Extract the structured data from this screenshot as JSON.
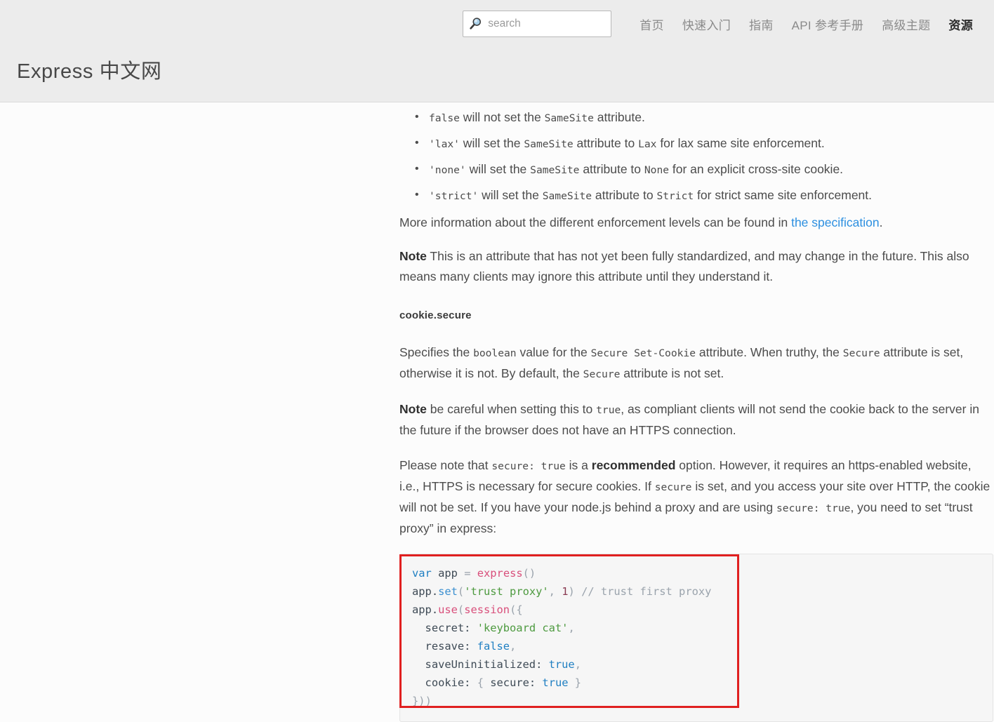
{
  "header": {
    "brand": "Express 中文网",
    "search": {
      "placeholder": "search",
      "value": "",
      "icon": "search-icon"
    },
    "nav": [
      {
        "label": "首页",
        "active": false
      },
      {
        "label": "快速入门",
        "active": false
      },
      {
        "label": "指南",
        "active": false
      },
      {
        "label": "API 参考手册",
        "active": false
      },
      {
        "label": "高级主题",
        "active": false
      },
      {
        "label": "资源",
        "active": true
      }
    ]
  },
  "content": {
    "samesite_bullets": [
      {
        "code": "false",
        "rest": " will not set the ",
        "code2": "SameSite",
        "rest2": " attribute.",
        "code3": "",
        "rest3": ""
      },
      {
        "code": "'lax'",
        "rest": " will set the ",
        "code2": "SameSite",
        "rest2": " attribute to ",
        "code3": "Lax",
        "rest3": " for lax same site enforcement."
      },
      {
        "code": "'none'",
        "rest": " will set the ",
        "code2": "SameSite",
        "rest2": " attribute to ",
        "code3": "None",
        "rest3": " for an explicit cross-site cookie."
      },
      {
        "code": "'strict'",
        "rest": " will set the ",
        "code2": "SameSite",
        "rest2": " attribute to ",
        "code3": "Strict",
        "rest3": " for strict same site enforcement."
      }
    ],
    "spec_paragraph": {
      "before": "More information about the different enforcement levels can be found in ",
      "link": "the specification",
      "after": "."
    },
    "note_1": {
      "label": "Note",
      "text": " This is an attribute that has not yet been fully standardized, and may change in the future. This also means many clients may ignore this attribute until they understand it."
    },
    "heading": "cookie.secure",
    "specifies_paragraph": {
      "p1": "Specifies the ",
      "c1": "boolean",
      "p2": " value for the ",
      "c2": "Secure Set-Cookie",
      "p3": " attribute. When truthy, the ",
      "c3": "Secure",
      "p4": " attribute is set, otherwise it is not. By default, the ",
      "c4": "Secure",
      "p5": " attribute is not set."
    },
    "note_2": {
      "label": "Note",
      "p1": " be careful when setting this to ",
      "c1": "true",
      "p2": ", as compliant clients will not send the cookie back to the server in the future if the browser does not have an HTTPS connection."
    },
    "please_note_paragraph": {
      "p1": "Please note that ",
      "c1": "secure: true",
      "p2": " is a ",
      "b1": "recommended",
      "p3": " option. However, it requires an https-enabled website, i.e., HTTPS is necessary for secure cookies. If ",
      "c2": "secure",
      "p4": " is set, and you access your site over HTTP, the cookie will not be set. If you have your node.js behind a proxy and are using ",
      "c3": "secure: true",
      "p5": ", you need to set ",
      "q1": "“trust proxy”",
      "p6": " in express:"
    },
    "code_sample": {
      "language": "javascript",
      "lines": [
        "var app = express()",
        "app.set('trust proxy', 1) // trust first proxy",
        "app.use(session({",
        "  secret: 'keyboard cat',",
        "  resave: false,",
        "  saveUninitialized: true,",
        "  cookie: { secure: true }",
        "}))"
      ],
      "highlight_color": "#e02020"
    }
  }
}
